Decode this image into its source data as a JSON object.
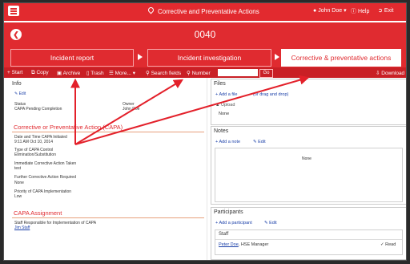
{
  "header": {
    "title": "Corrective and Preventative Actions",
    "user": "John Doe",
    "help": "Help",
    "exit": "Exit"
  },
  "record": {
    "id": "0040"
  },
  "steps": [
    "Incident report",
    "Incident investigation",
    "Corrective & preventative actions"
  ],
  "toolbar": {
    "start": "Start",
    "copy": "Copy",
    "archive": "Archive",
    "trash": "Trash",
    "more": "More...",
    "search_fields": "Search fields",
    "number": "Number",
    "go": "Go",
    "download": "Download"
  },
  "info": {
    "title": "Info",
    "edit": "Edit",
    "status_label": "Status",
    "status_value": "CAPA Pending Completion",
    "owner_label": "Owner",
    "owner_value": "John Doe"
  },
  "capa": {
    "title": "Corrective or Preventative Action (CAPA)",
    "date_label": "Date and Time CAPA Initiated",
    "date_value": "9:11 AM Oct 10, 2014",
    "type_label": "Type of CAPA Control",
    "type_value": "Elimination/Substitution",
    "immediate_label": "Immediate Corrective Action Taken",
    "immediate_value": "test",
    "further_label": "Further Corrective Action Required",
    "further_value": "None",
    "priority_label": "Priority of CAPA Implementation",
    "priority_value": "Low"
  },
  "assignment": {
    "title": "CAPA Assignment",
    "staff_label": "Staff Responsible for Implementation of CAPA",
    "staff_value": "Jim Staff"
  },
  "files": {
    "title": "Files",
    "add": "Add a file",
    "drop": "(or drag and drop)",
    "upload": "Upload",
    "none": "None"
  },
  "notes": {
    "title": "Notes",
    "add": "Add a note",
    "edit": "Edit",
    "none": "None"
  },
  "participants": {
    "title": "Participants",
    "add": "Add a participant",
    "edit": "Edit",
    "staff_header": "Staff",
    "person": "Peter Doe",
    "role": ", HSE Manager",
    "read": "Read"
  },
  "colors": {
    "brand_red": "#e22a2f",
    "annotation_red": "#e3202a",
    "link_blue": "#1a3fa8"
  }
}
